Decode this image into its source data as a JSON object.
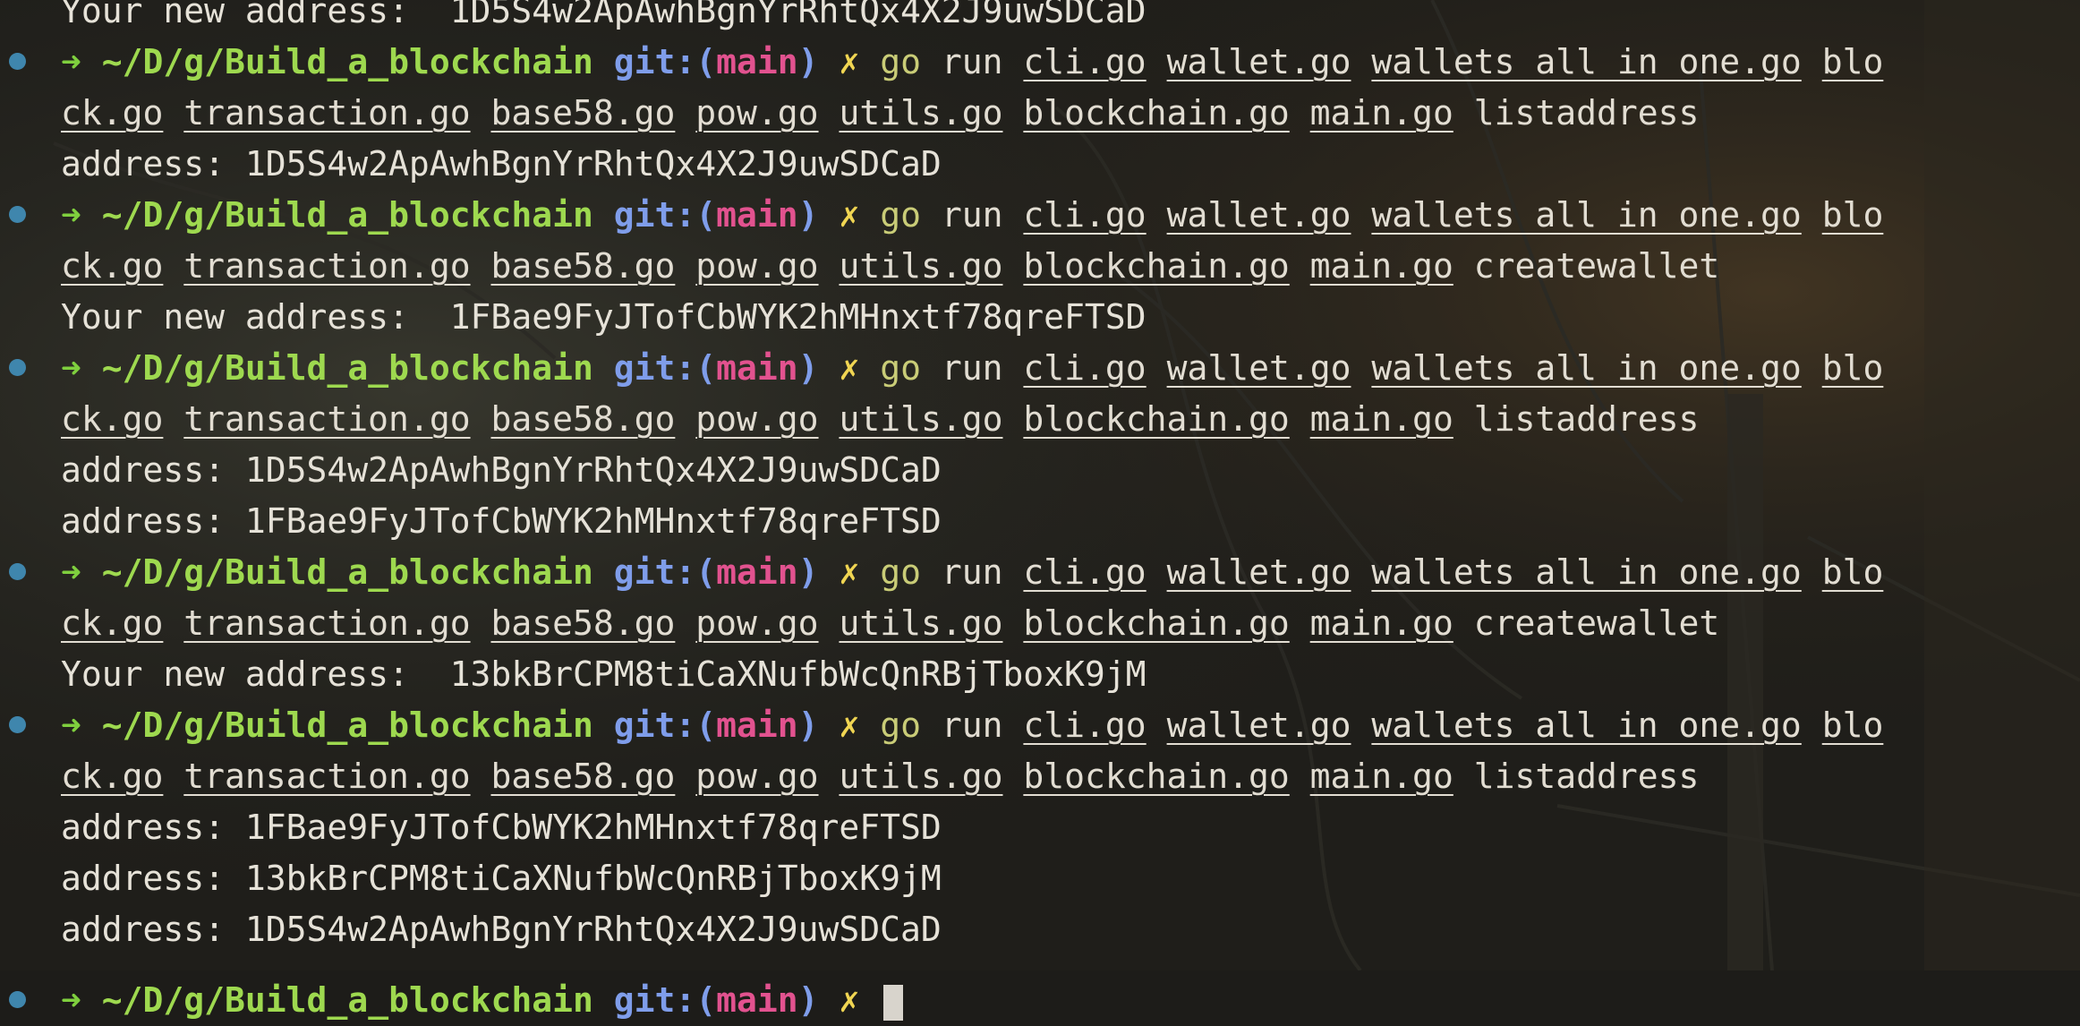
{
  "prompt": {
    "arrow": "➜",
    "path": "~/D/g/Build_a_blockchain",
    "git_prefix": "git:(",
    "branch": "main",
    "git_suffix": ")",
    "dirty": "✗"
  },
  "command": {
    "go": "go",
    "run": "run",
    "files_line1": [
      "cli.go",
      "wallet.go",
      "wallets_all_in_one.go",
      "blo"
    ],
    "files_line2": [
      "ck.go",
      "transaction.go",
      "base58.go",
      "pow.go",
      "utils.go",
      "blockchain.go",
      "main.go"
    ]
  },
  "lines": [
    {
      "type": "out",
      "text": "Your new address:  1D5S4w2ApAwhBgnYrRhtQx4X2J9uwSDCaD"
    },
    {
      "type": "cmd1"
    },
    {
      "type": "cmd2",
      "subcommand": "listaddress"
    },
    {
      "type": "out",
      "text": "address: 1D5S4w2ApAwhBgnYrRhtQx4X2J9uwSDCaD"
    },
    {
      "type": "cmd1"
    },
    {
      "type": "cmd2",
      "subcommand": "createwallet"
    },
    {
      "type": "out",
      "text": "Your new address:  1FBae9FyJTofCbWYK2hMHnxtf78qreFTSD"
    },
    {
      "type": "cmd1"
    },
    {
      "type": "cmd2",
      "subcommand": "listaddress"
    },
    {
      "type": "out",
      "text": "address: 1D5S4w2ApAwhBgnYrRhtQx4X2J9uwSDCaD"
    },
    {
      "type": "out",
      "text": "address: 1FBae9FyJTofCbWYK2hMHnxtf78qreFTSD"
    },
    {
      "type": "cmd1"
    },
    {
      "type": "cmd2",
      "subcommand": "createwallet"
    },
    {
      "type": "out",
      "text": "Your new address:  13bkBrCPM8tiCaXNufbWcQnRBjTboxK9jM"
    },
    {
      "type": "cmd1"
    },
    {
      "type": "cmd2",
      "subcommand": "listaddress"
    },
    {
      "type": "out",
      "text": "address: 1FBae9FyJTofCbWYK2hMHnxtf78qreFTSD"
    },
    {
      "type": "out",
      "text": "address: 13bkBrCPM8tiCaXNufbWcQnRBjTboxK9jM"
    },
    {
      "type": "out",
      "text": "address: 1D5S4w2ApAwhBgnYrRhtQx4X2J9uwSDCaD"
    },
    {
      "type": "prompt_partial"
    }
  ],
  "colors": {
    "background": "#1d1c19",
    "prompt_dot": "#3f86ad",
    "arrow": "#7fcf3e",
    "path": "#9ed94f",
    "git": "#7f9dea",
    "branch": "#e2528f",
    "dirty": "#f0d552",
    "go_keyword": "#c9cc77",
    "text": "#e2ddd2"
  }
}
